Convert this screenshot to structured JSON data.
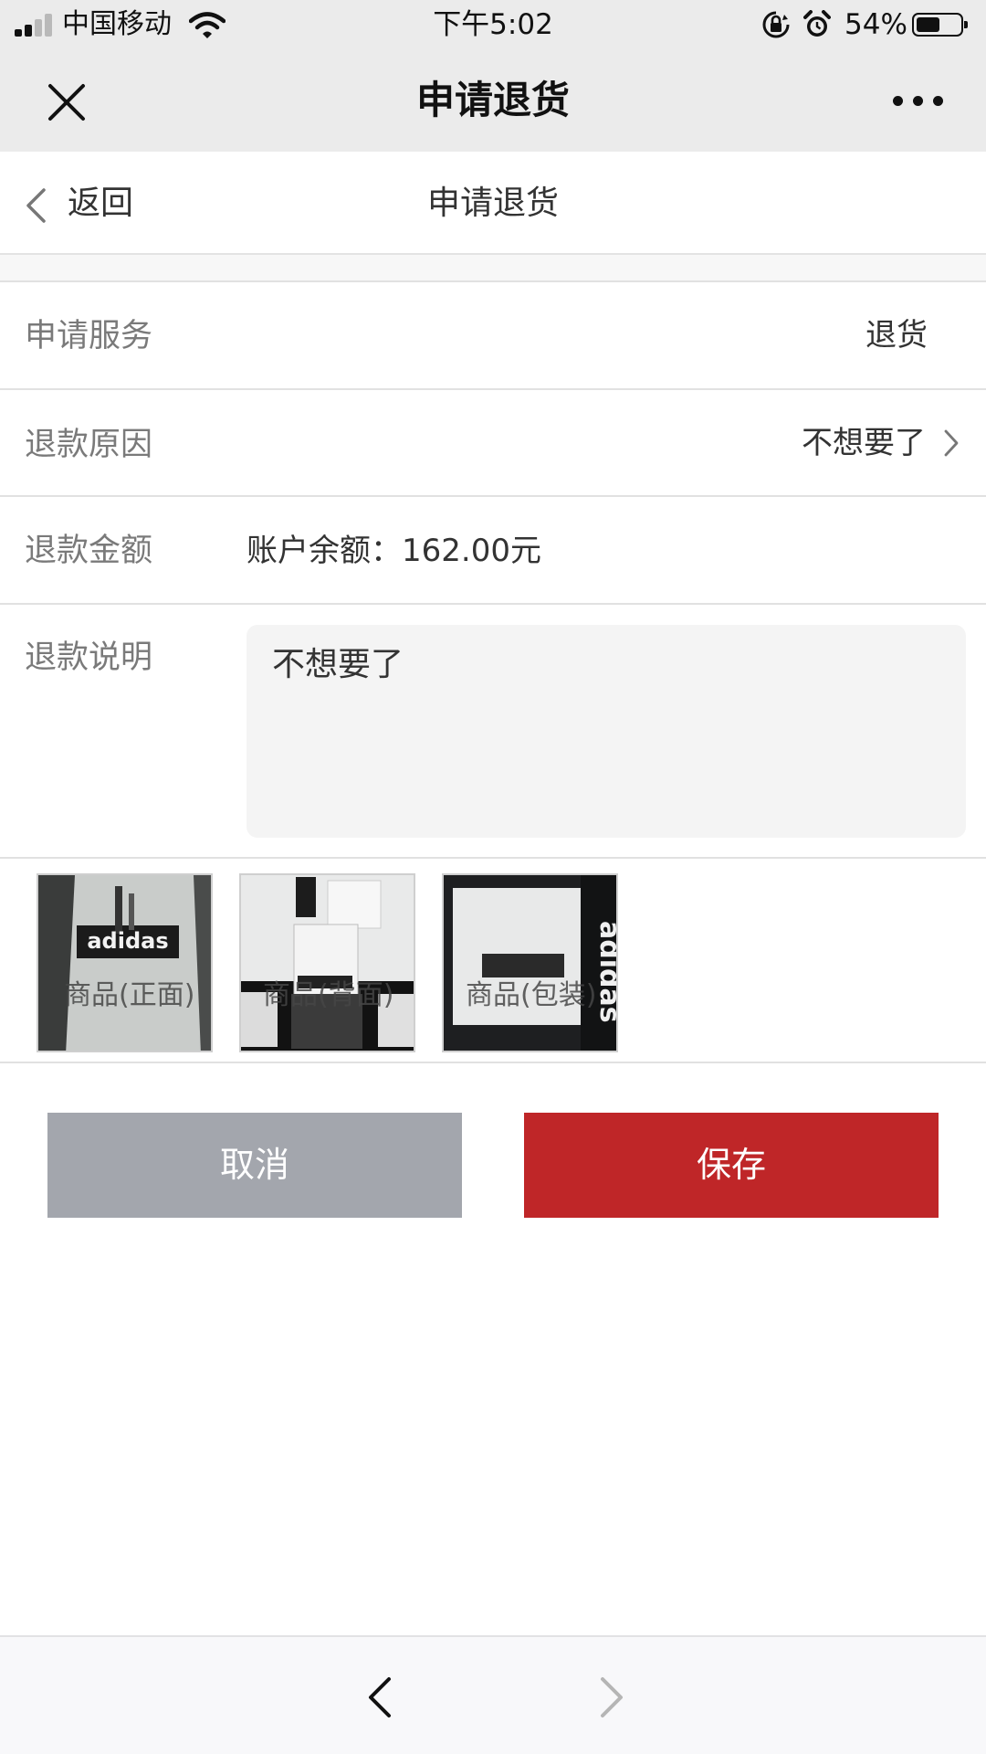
{
  "status_bar": {
    "carrier": "中国移动",
    "time": "下午5:02",
    "battery_text": "54%",
    "battery_level": 0.54,
    "signal_bars": 2,
    "icons": [
      "signal-icon",
      "wifi-icon",
      "orientation-lock-icon",
      "alarm-icon",
      "battery-icon"
    ]
  },
  "wechat_nav": {
    "title": "申请退货",
    "close_icon": "close-icon",
    "more_icon": "more-icon"
  },
  "page_header": {
    "back_label": "返回",
    "title": "申请退货"
  },
  "form": {
    "service": {
      "label": "申请服务",
      "value": "退货"
    },
    "reason": {
      "label": "退款原因",
      "value": "不想要了"
    },
    "amount": {
      "label": "退款金额",
      "value": "账户余额：162.00元"
    },
    "remark": {
      "label": "退款说明",
      "value": "不想要了"
    }
  },
  "photos": [
    {
      "label": "商品(正面)"
    },
    {
      "label": "商品(背面)"
    },
    {
      "label": "商品(包装)"
    }
  ],
  "buttons": {
    "cancel": "取消",
    "save": "保存"
  },
  "colors": {
    "save_button": "#bf2628",
    "cancel_button": "#a3a6ad",
    "wechat_bar": "#ebebeb"
  }
}
